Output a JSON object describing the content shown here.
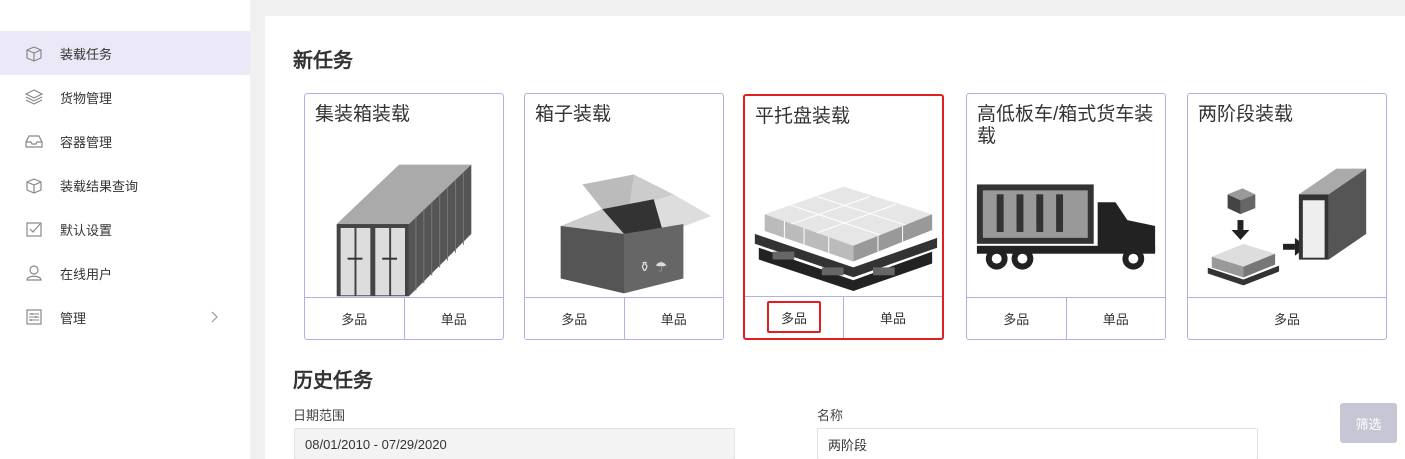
{
  "sidebar": {
    "items": [
      {
        "label": "装载任务",
        "icon": "box-icon"
      },
      {
        "label": "货物管理",
        "icon": "layers-icon"
      },
      {
        "label": "容器管理",
        "icon": "tray-icon"
      },
      {
        "label": "装载结果查询",
        "icon": "box-search-icon"
      },
      {
        "label": "默认设置",
        "icon": "checkbox-icon"
      },
      {
        "label": "在线用户",
        "icon": "user-icon"
      },
      {
        "label": "管理",
        "icon": "settings-panel-icon"
      }
    ]
  },
  "new_task": {
    "title": "新任务",
    "cards": [
      {
        "title": "集装箱装载",
        "buttons": [
          "多品",
          "单品"
        ]
      },
      {
        "title": "箱子装载",
        "buttons": [
          "多品",
          "单品"
        ]
      },
      {
        "title": "平托盘装载",
        "buttons": [
          "多品",
          "单品"
        ]
      },
      {
        "title": "高低板车/箱式货车装载",
        "buttons": [
          "多品",
          "单品"
        ]
      },
      {
        "title": "两阶段装载",
        "buttons": [
          "多品"
        ]
      }
    ]
  },
  "history": {
    "title": "历史任务",
    "date_label": "日期范围",
    "date_value": "08/01/2010 - 07/29/2020",
    "name_label": "名称",
    "name_value": "两阶段",
    "filter_label": "筛选"
  },
  "colors": {
    "accent_border": "#b3aee6",
    "active_nav": "#ebe9f8",
    "highlight": "#e02020"
  }
}
